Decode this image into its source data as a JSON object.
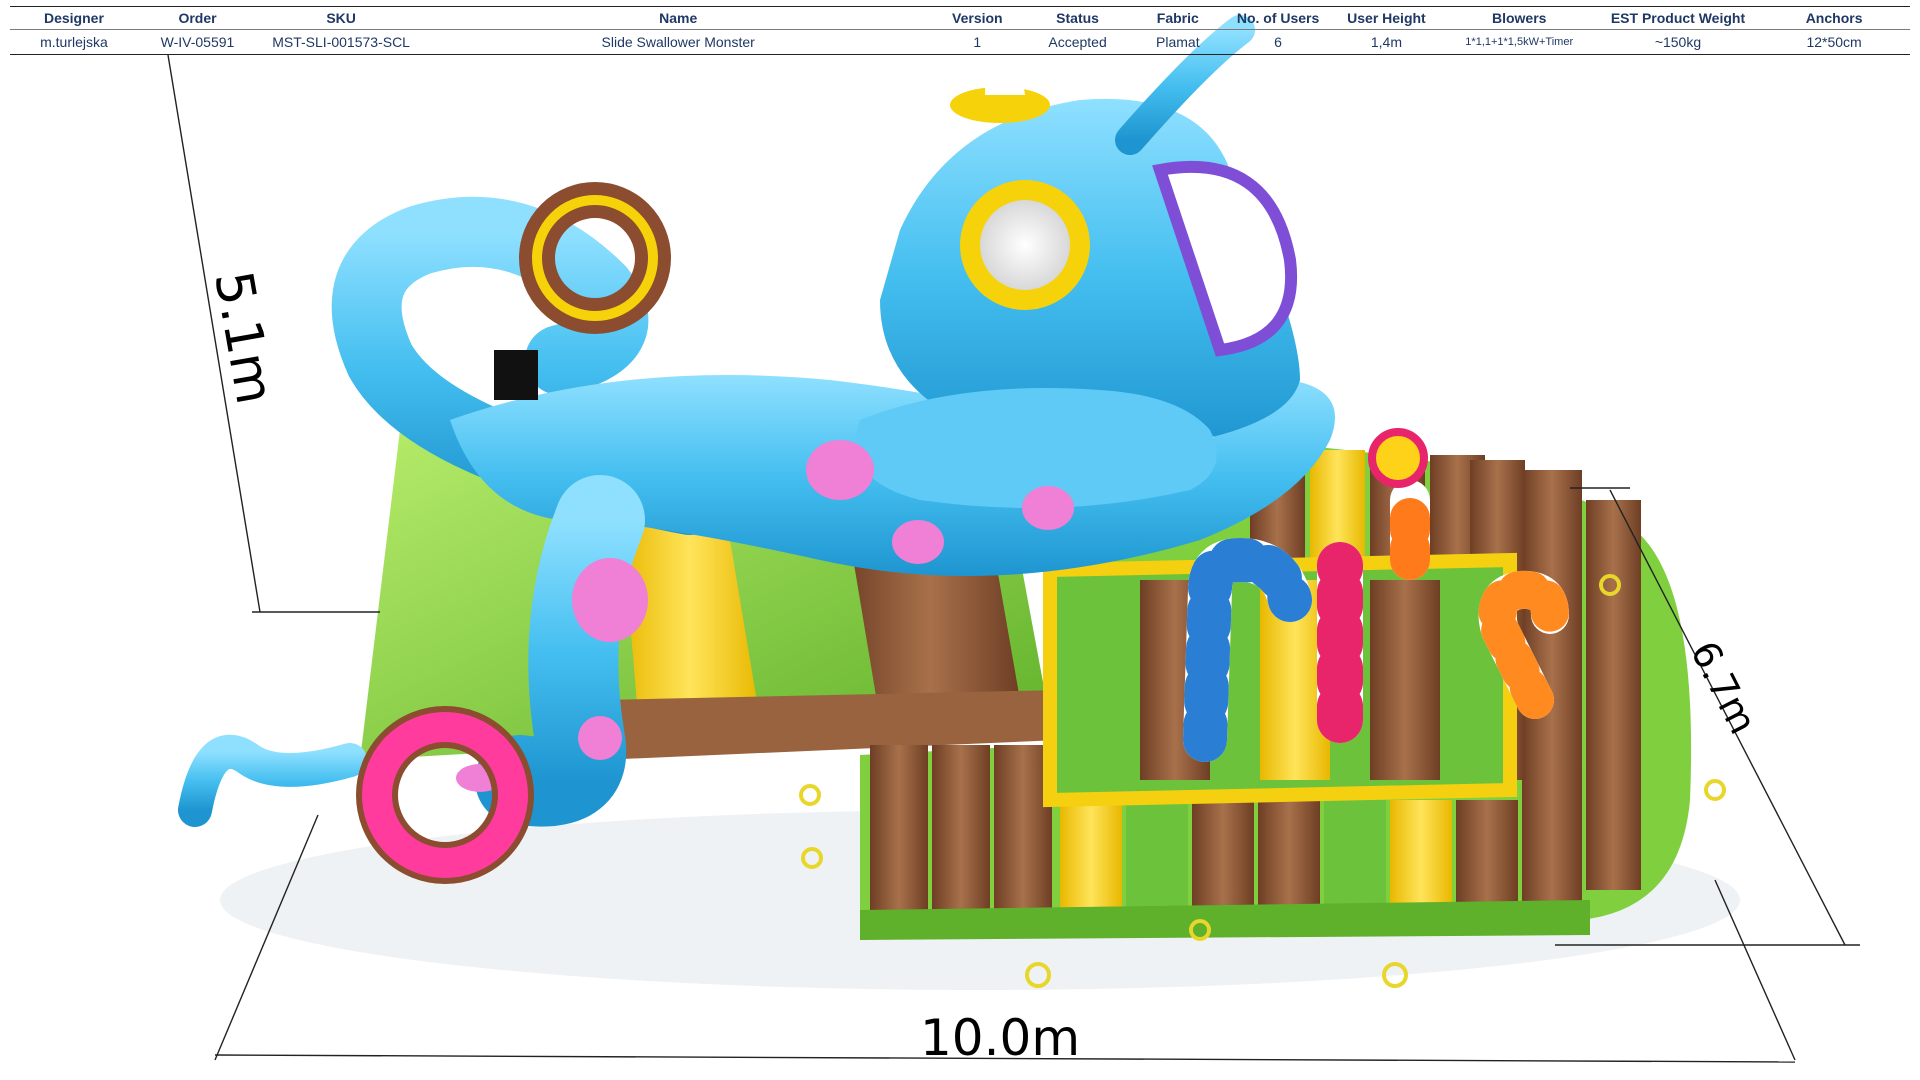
{
  "spec_table": {
    "headers": {
      "designer": "Designer",
      "order": "Order",
      "sku": "SKU",
      "name": "Name",
      "version": "Version",
      "status": "Status",
      "fabric": "Fabric",
      "users": "No. of Users",
      "user_height": "User  Height",
      "blowers": "Blowers",
      "weight": "EST Product Weight",
      "anchors": "Anchors"
    },
    "row": {
      "designer": "m.turlejska",
      "order": "W-IV-05591",
      "sku": "MST-SLI-001573-SCL",
      "name": "Slide Swallower Monster",
      "version": "1",
      "status": "Accepted",
      "fabric": "Plamat",
      "users": "6",
      "user_height": "1,4m",
      "blowers": "1*1,1+1*1,5kW+Timer",
      "weight": "~150kg",
      "anchors": "12*50cm"
    }
  },
  "dimensions": {
    "height": "5.1m",
    "depth": "6.7m",
    "width": "10.0m"
  },
  "colors": {
    "header_text": "#1f3864",
    "monster_blue": "#45bff0",
    "spot_pink": "#f07fd6",
    "ring_yellow": "#f6d20a",
    "floor_brown": "#8a5a3a",
    "floor_green": "#8ed14a",
    "floor_yellow": "#f7d21a",
    "donut_pink": "#ff3c9d",
    "donut_brown": "#8b4c2f"
  },
  "icons": {
    "anchor": "anchor-ring-icon"
  }
}
